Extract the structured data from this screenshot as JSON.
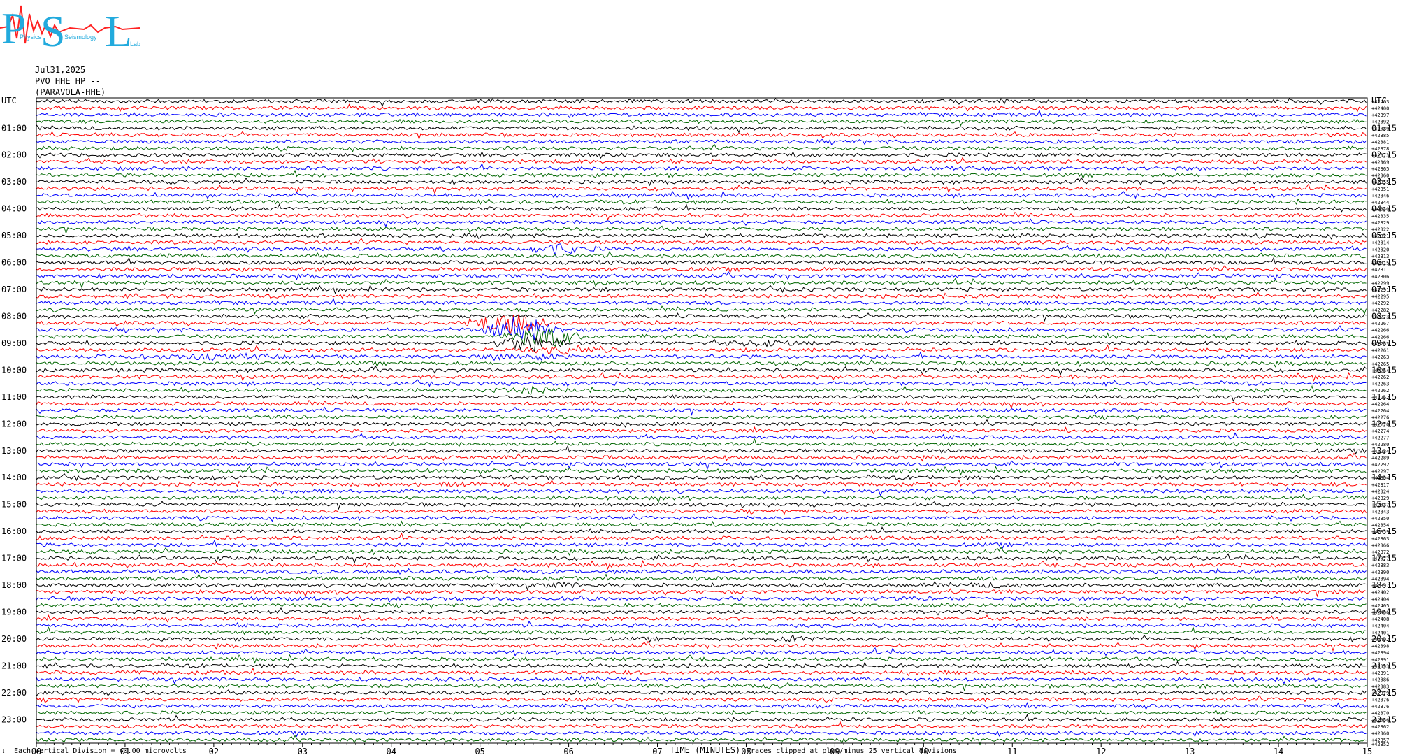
{
  "logo": {
    "letters": [
      "P",
      "S",
      "L"
    ],
    "small_words": [
      "Physics",
      "Seismology",
      "Lab"
    ]
  },
  "header": {
    "date": "Jul31,2025",
    "station": "PVO HHE HP --",
    "site": "(PARAVOLA-HHE)"
  },
  "chart_data": {
    "type": "helicorder",
    "x_unit_label": "TIME (MINUTES)",
    "x_ticks": [
      "00",
      "01",
      "02",
      "03",
      "04",
      "05",
      "06",
      "07",
      "08",
      "09",
      "10",
      "11",
      "12",
      "13",
      "14",
      "15"
    ],
    "left_label_top": "UTC",
    "right_label_top": "UTC",
    "left_hours": [
      "01:00",
      "02:00",
      "03:00",
      "04:00",
      "05:00",
      "06:00",
      "07:00",
      "08:00",
      "09:00",
      "10:00",
      "11:00",
      "12:00",
      "13:00",
      "14:00",
      "15:00",
      "16:00",
      "17:00",
      "18:00",
      "19:00",
      "20:00",
      "21:00",
      "22:00",
      "23:00"
    ],
    "right_hours": [
      "01:15",
      "02:15",
      "03:15",
      "04:15",
      "05:15",
      "06:15",
      "07:15",
      "08:15",
      "09:15",
      "10:15",
      "11:15",
      "12:15",
      "13:15",
      "14:15",
      "15:15",
      "16:15",
      "17:15",
      "18:15",
      "19:15",
      "20:15",
      "21:15",
      "22:15",
      "23:15"
    ],
    "line_count": 96,
    "minutes_per_line": 15,
    "trace_colors": [
      "#000000",
      "#ff0000",
      "#0000ff",
      "#006600"
    ],
    "right_values": [
      42403,
      42400,
      42397,
      42392,
      42389,
      42385,
      42381,
      42378,
      42373,
      42369,
      42365,
      42360,
      42355,
      42351,
      42346,
      42344,
      42340,
      42335,
      42329,
      42322,
      42321,
      42314,
      42320,
      42313,
      42315,
      42311,
      42306,
      42299,
      42291,
      42295,
      42292,
      42282,
      42273,
      42267,
      42266,
      42266,
      42263,
      42261,
      42263,
      42265,
      42264,
      42262,
      42263,
      42262,
      42262,
      42264,
      42264,
      42276,
      42270,
      42274,
      42277,
      42280,
      42284,
      42289,
      42292,
      42297,
      42304,
      42317,
      42324,
      42329,
      42337,
      42343,
      42350,
      42354,
      42359,
      42363,
      42366,
      42372,
      42377,
      42383,
      42390,
      42394,
      42397,
      42402,
      42404,
      42405,
      42406,
      42408,
      42404,
      42401,
      42402,
      42398,
      42394,
      42391,
      42393,
      42391,
      42386,
      42383,
      42379,
      42376,
      42376,
      42370,
      42366,
      42362,
      42360,
      42357
    ],
    "right_last": "42352",
    "events": [
      {
        "line": 22,
        "minute": 5.85,
        "amp": 3.5,
        "dur": 0.55
      },
      {
        "line": 33,
        "minute": 5.3,
        "amp": 8.0,
        "dur": 0.5
      },
      {
        "line": 34,
        "minute": 5.45,
        "amp": 9.0,
        "dur": 0.5
      },
      {
        "line": 35,
        "minute": 5.7,
        "amp": 7.5,
        "dur": 0.5
      },
      {
        "line": 36,
        "minute": 5.55,
        "amp": 5.0,
        "dur": 0.5
      },
      {
        "line": 37,
        "minute": 6.0,
        "amp": 2.5,
        "dur": 0.6
      },
      {
        "line": 38,
        "minute": 5.5,
        "amp": 3.0,
        "dur": 0.6
      },
      {
        "line": 43,
        "minute": 5.6,
        "amp": 2.2,
        "dur": 0.6
      },
      {
        "line": 36,
        "minute": 8.2,
        "amp": 2.5,
        "dur": 0.6
      },
      {
        "line": 38,
        "minute": 1.85,
        "amp": 2.0,
        "dur": 1.2
      },
      {
        "line": 57,
        "minute": 4.65,
        "amp": 1.8,
        "dur": 0.4
      },
      {
        "line": 72,
        "minute": 5.9,
        "amp": 1.8,
        "dur": 0.4
      },
      {
        "line": 72,
        "minute": 10.8,
        "amp": 1.8,
        "dur": 0.4
      },
      {
        "line": 80,
        "minute": 8.5,
        "amp": 3.0,
        "dur": 0.3
      },
      {
        "line": 87,
        "minute": 8.2,
        "amp": 1.5,
        "dur": 0.3
      }
    ]
  },
  "footer": {
    "left_mark": "↓",
    "vertical_division": "Each Vertical Division =   40.00 microvolts",
    "clip_note": "Traces clipped at plus/minus 25 vertical divisions"
  }
}
